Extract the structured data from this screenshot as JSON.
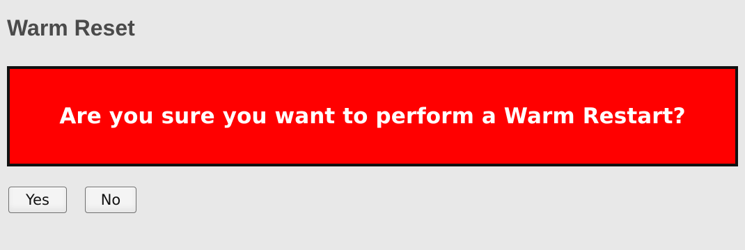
{
  "page": {
    "title": "Warm Reset"
  },
  "warning": {
    "message": "Are you sure you want to perform a Warm Restart?",
    "background_color": "#ff0000",
    "border_color": "#111111",
    "text_color": "#ffffff"
  },
  "actions": {
    "yes_label": "Yes",
    "no_label": "No"
  }
}
